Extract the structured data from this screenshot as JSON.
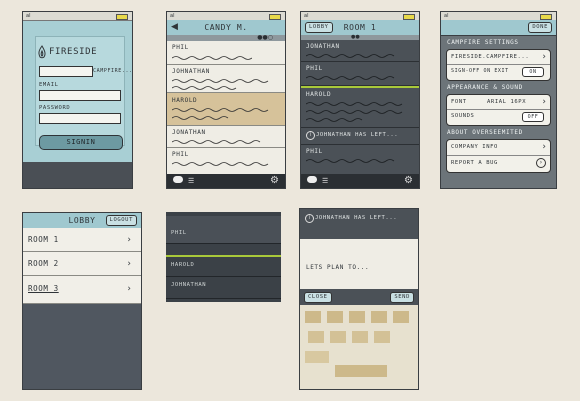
{
  "common": {
    "signal": "al"
  },
  "login": {
    "app_name": "FIRESIDE",
    "campfire_hint": "CAMPFIRE...",
    "email_label": "EMAIL",
    "password_label": "PASSWORD",
    "signin_label": "SIGNIN"
  },
  "contact": {
    "title": "CANDY M.",
    "names": [
      "PHIL",
      "JOHNATHAN",
      "HAROLD",
      "JONATHAN",
      "PHIL"
    ]
  },
  "room": {
    "back_label": "LOBBY",
    "title": "ROOM 1",
    "names": [
      "JONATHAN",
      "PHIL",
      "HAROLD",
      "PHIL"
    ],
    "notice": "JOHNATHAN HAS LEFT..."
  },
  "settings": {
    "done_label": "DONE",
    "campfire_header": "CAMPFIRE SETTINGS",
    "campfire_value": "FIRESIDE.CAMPFIRE...",
    "signin_toggle": "SIGN-OFF ON EXIT",
    "toggle_on": "ON",
    "appearance_header": "APPEARANCE & SOUND",
    "font_label": "FONT",
    "font_value": "ARIAL 16PX",
    "sounds_label": "SOUNDS",
    "sounds_toggle": "OFF",
    "about_header": "ABOUT OVERSEEMITED",
    "company_info": "COMPANY INFO",
    "report_bug": "REPORT A BUG"
  },
  "lobby": {
    "title": "LOBBY",
    "logout_label": "LOGOUT",
    "rooms": [
      "ROOM 1",
      "ROOM 2",
      "ROOM 3"
    ]
  },
  "frag": {
    "names": [
      "PHIL",
      "HAROLD",
      "JOHNATHAN"
    ]
  },
  "compose": {
    "notice": "JOHNATHAN HAS LEFT...",
    "draft": "LETS PLAN TO...",
    "close_label": "CLOSE",
    "send_label": "SEND"
  }
}
